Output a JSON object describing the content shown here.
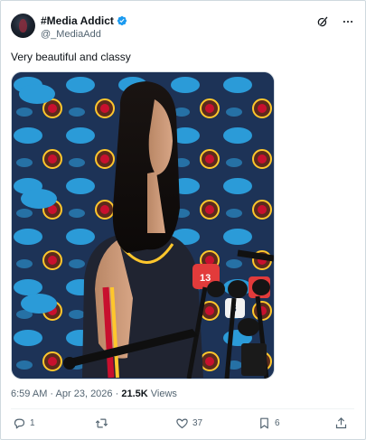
{
  "author": {
    "display_name": "#Media Addict",
    "handle": "@_MediaAdd"
  },
  "tweet": {
    "text": "Very beautiful and classy"
  },
  "media": {
    "backdrop_sponsor": "salesforce",
    "backdrop_team": "Indiana Fever",
    "mic_labels": [
      "13",
      "13",
      "8"
    ]
  },
  "meta": {
    "time": "6:59 AM",
    "date": "Apr 23, 2026",
    "separator": "·",
    "views_count": "21.5K",
    "views_label": "Views"
  },
  "actions": {
    "replies": "1",
    "reposts": "",
    "likes": "37",
    "bookmarks": "6"
  },
  "colors": {
    "verified": "#1d9bf0",
    "backdrop_navy": "#1d3357",
    "salesforce_blue": "#2b9bd8",
    "fever_red": "#c8102e",
    "fever_gold": "#ffc72c"
  }
}
